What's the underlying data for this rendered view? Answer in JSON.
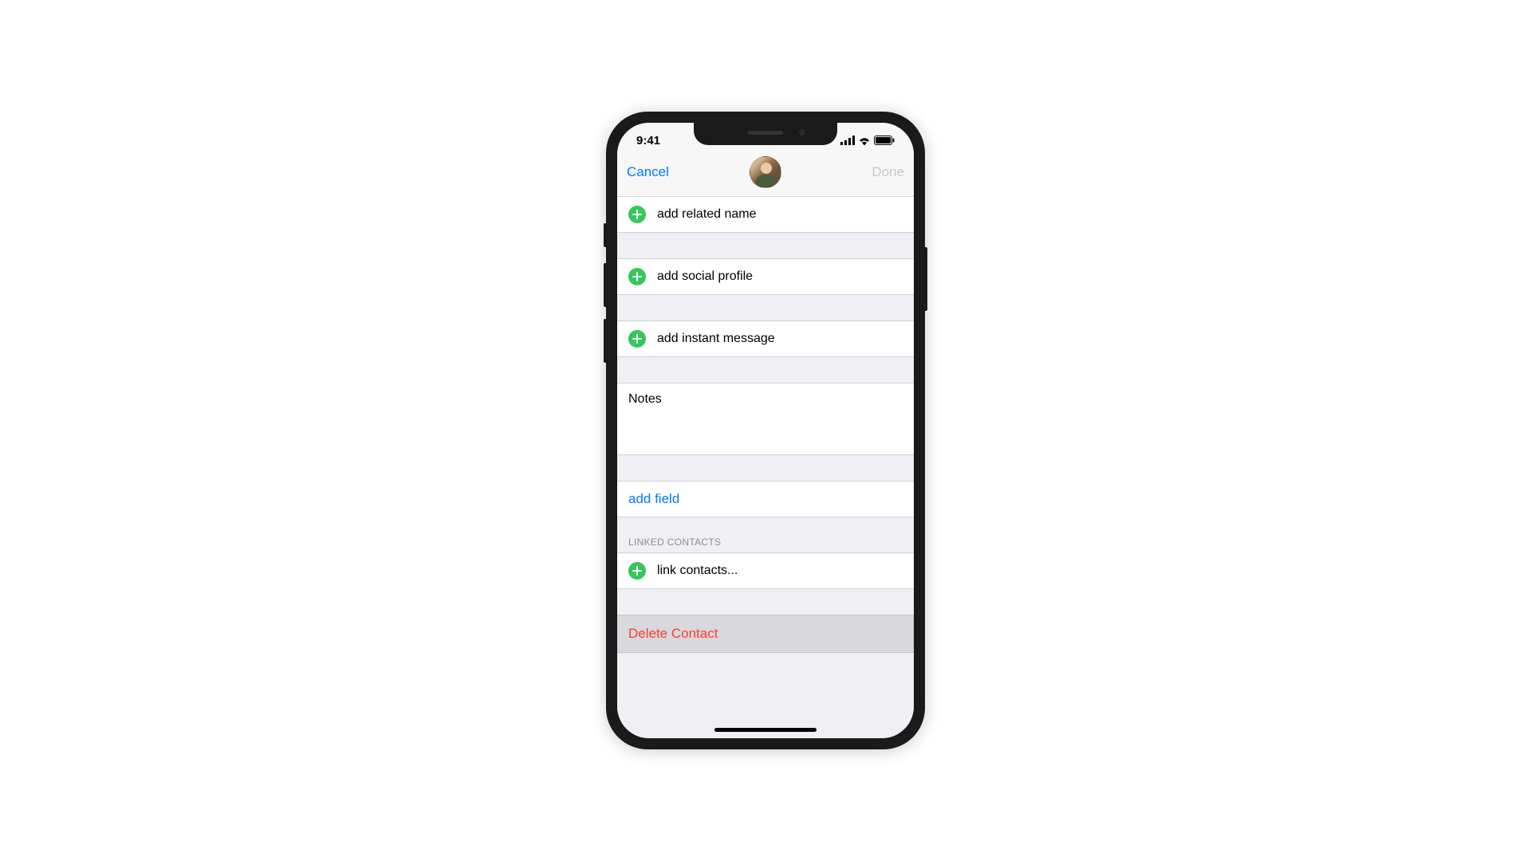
{
  "status": {
    "time": "9:41"
  },
  "nav": {
    "cancel": "Cancel",
    "done": "Done"
  },
  "rows": {
    "related_name": "add related name",
    "social_profile": "add social profile",
    "instant_message": "add instant message",
    "notes_label": "Notes",
    "add_field": "add field",
    "linked_header": "LINKED CONTACTS",
    "link_contacts": "link contacts...",
    "delete": "Delete Contact"
  }
}
